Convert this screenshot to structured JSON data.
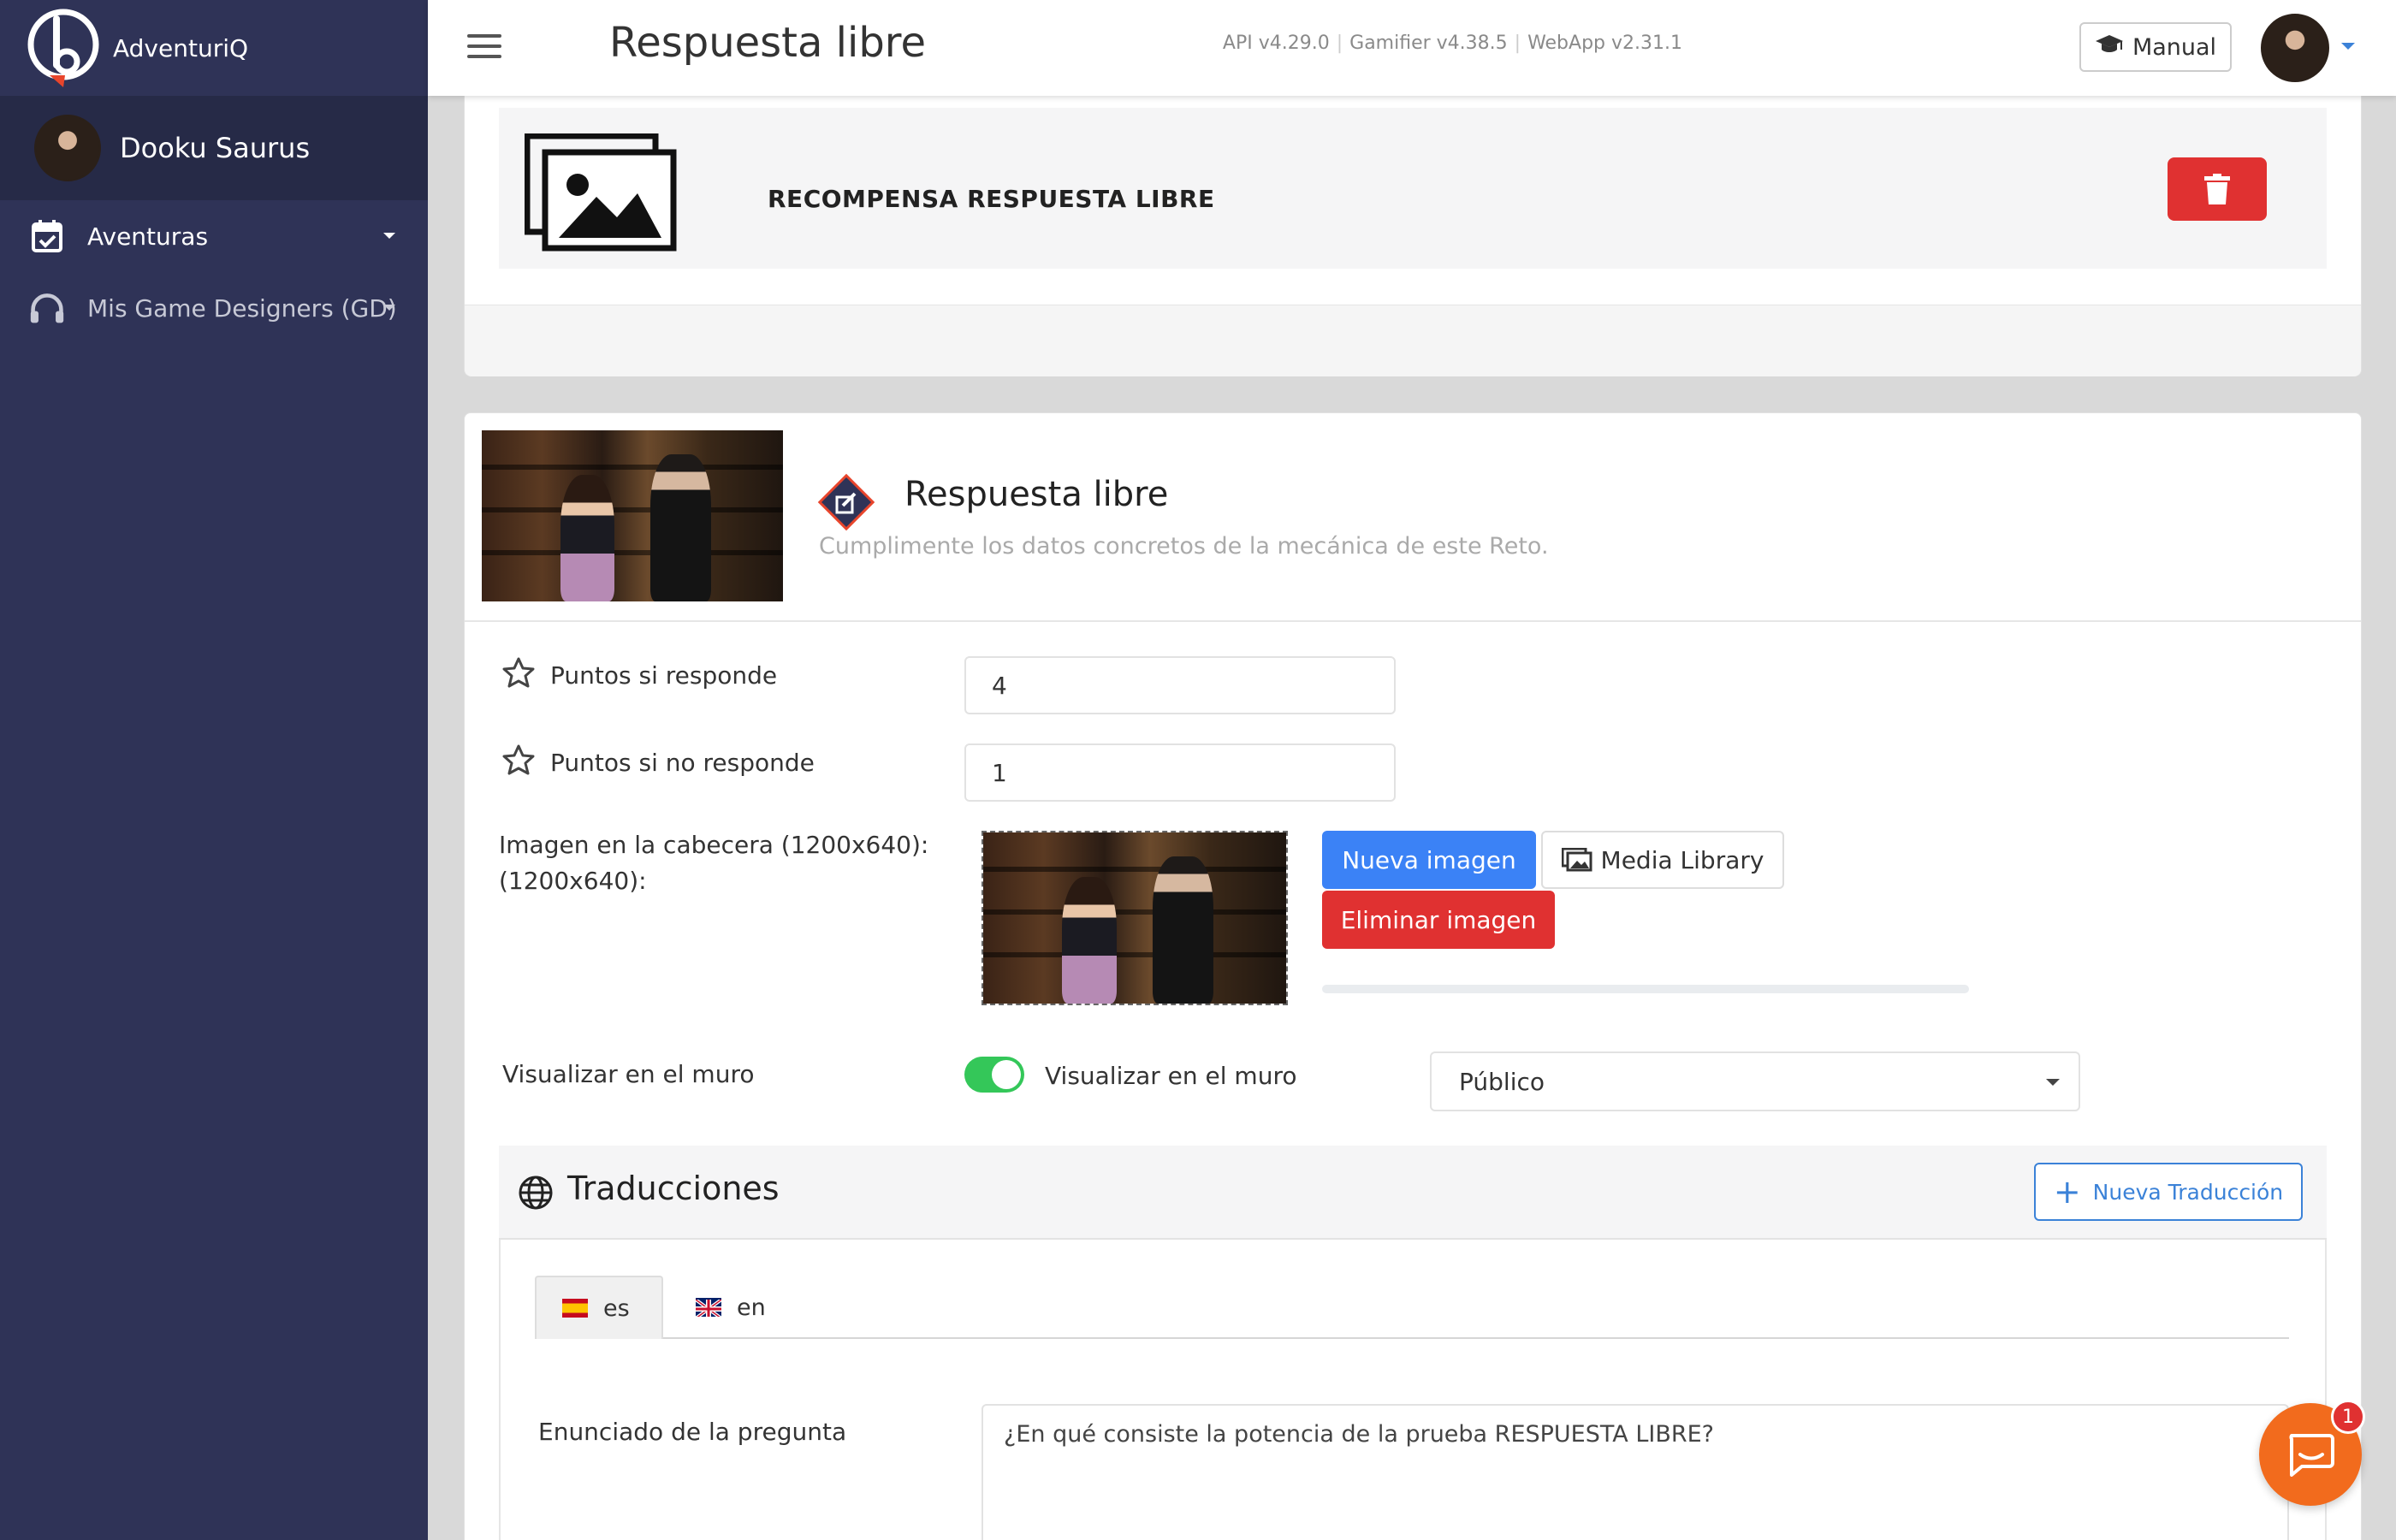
{
  "brand": {
    "name": "AdventuriQ"
  },
  "user": {
    "name": "Dooku Saurus"
  },
  "sidebar": {
    "items": [
      {
        "label": "Aventuras",
        "icon": "calendar-check-icon"
      },
      {
        "label": "Mis Game Designers (GD)",
        "icon": "headphones-icon"
      }
    ]
  },
  "topbar": {
    "title": "Respuesta libre",
    "versions": {
      "api": "API v4.29.0",
      "gamifier": "Gamifier v4.38.5",
      "webapp": "WebApp v2.31.1"
    },
    "manual_label": "Manual"
  },
  "reward": {
    "title": "RECOMPENSA RESPUESTA LIBRE"
  },
  "mechanic": {
    "title": "Respuesta libre",
    "subtitle": "Cumplimente los datos concretos de la mecánica de este Reto."
  },
  "form": {
    "points_answer_label": "Puntos si responde",
    "points_answer_value": "4",
    "points_no_answer_label": "Puntos si no responde",
    "points_no_answer_value": "1",
    "header_image_label_1": "Imagen en la cabecera (1200x640):",
    "header_image_label_2": "(1200x640):",
    "new_image_label": "Nueva imagen",
    "media_library_label": "Media Library",
    "delete_image_label": "Eliminar imagen",
    "upload_progress": 0,
    "wall_label": "Visualizar en el muro",
    "wall_toggle_label": "Visualizar en el muro",
    "wall_toggle_on": true,
    "visibility_selected": "Público"
  },
  "translations": {
    "title": "Traducciones",
    "new_label": "Nueva Traducción",
    "tabs": [
      {
        "label": "es"
      },
      {
        "label": "en"
      }
    ],
    "question_label": "Enunciado de la pregunta",
    "question_value": "¿En qué consiste la potencia de la prueba RESPUESTA LIBRE?"
  },
  "chat": {
    "badge": "1"
  },
  "colors": {
    "sidebar_bg": "#2f3357",
    "primary": "#3b82f6",
    "danger": "#e03131",
    "toggle_on": "#34c759",
    "chat": "#f26b1d"
  }
}
